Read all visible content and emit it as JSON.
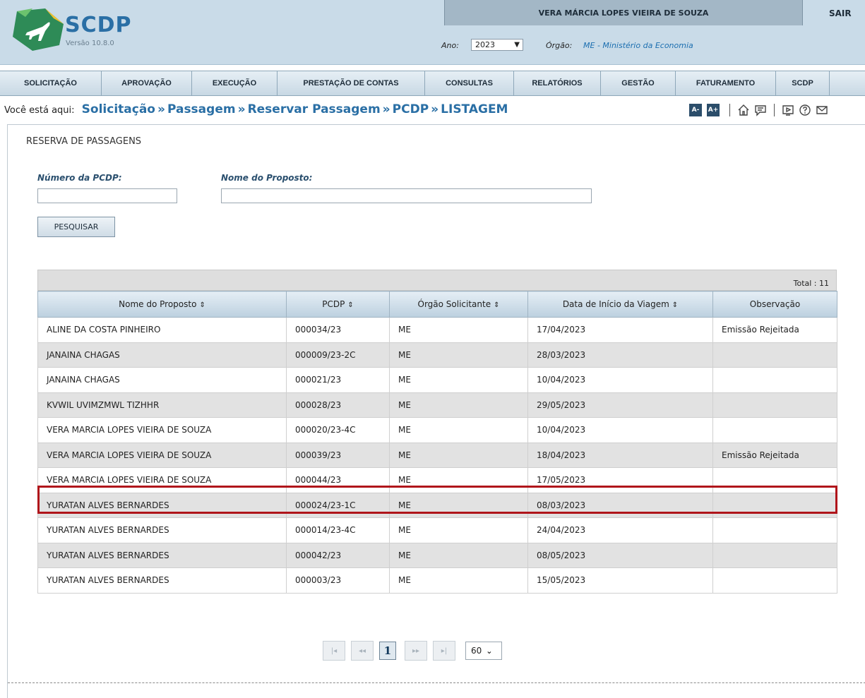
{
  "header": {
    "brand": "SCDP",
    "version": "Versão 10.8.0",
    "user_name": "VERA MÁRCIA LOPES VIEIRA DE SOUZA",
    "logout": "SAIR",
    "year_label": "Ano:",
    "year_value": "2023",
    "org_label": "Órgão:",
    "org_value": "ME - Ministério da Economia"
  },
  "menu": [
    {
      "label": "SOLICITAÇÃO"
    },
    {
      "label": "APROVAÇÃO"
    },
    {
      "label": "EXECUÇÃO"
    },
    {
      "label": "PRESTAÇÃO DE CONTAS"
    },
    {
      "label": "CONSULTAS"
    },
    {
      "label": "RELATÓRIOS"
    },
    {
      "label": "GESTÃO"
    },
    {
      "label": "FATURAMENTO"
    },
    {
      "label": "SCDP"
    }
  ],
  "breadcrumb": {
    "lead": "Você está aqui:",
    "items": [
      "Solicitação",
      "Passagem",
      "Reservar Passagem",
      "PCDP",
      "LISTAGEM"
    ],
    "separator": "»"
  },
  "tools": {
    "font_decrease": "A-",
    "font_increase": "A+"
  },
  "form": {
    "section_title": "RESERVA DE PASSAGENS",
    "pcdp_label": "Número da PCDP:",
    "pcdp_value": "",
    "name_label": "Nome do Proposto:",
    "name_value": "",
    "search_button": "PESQUISAR"
  },
  "table": {
    "total_label": "Total : 11",
    "columns": [
      {
        "label": "Nome do Proposto",
        "sortable": true
      },
      {
        "label": "PCDP",
        "sortable": true
      },
      {
        "label": "Órgão Solicitante",
        "sortable": true
      },
      {
        "label": "Data de Início da Viagem",
        "sortable": true
      },
      {
        "label": "Observação",
        "sortable": false
      }
    ],
    "rows": [
      [
        "ALINE DA COSTA PINHEIRO",
        "000034/23",
        "ME",
        "17/04/2023",
        "Emissão Rejeitada"
      ],
      [
        "JANAINA CHAGAS",
        "000009/23-2C",
        "ME",
        "28/03/2023",
        ""
      ],
      [
        "JANAINA CHAGAS",
        "000021/23",
        "ME",
        "10/04/2023",
        ""
      ],
      [
        "KVWIL UVIMZMWL TIZHHR",
        "000028/23",
        "ME",
        "29/05/2023",
        ""
      ],
      [
        "VERA MARCIA LOPES VIEIRA DE SOUZA",
        "000020/23-4C",
        "ME",
        "10/04/2023",
        ""
      ],
      [
        "VERA MARCIA LOPES VIEIRA DE SOUZA",
        "000039/23",
        "ME",
        "18/04/2023",
        "Emissão Rejeitada"
      ],
      [
        "VERA MARCIA LOPES VIEIRA DE SOUZA",
        "000044/23",
        "ME",
        "17/05/2023",
        ""
      ],
      [
        "YURATAN ALVES BERNARDES",
        "000024/23-1C",
        "ME",
        "08/03/2023",
        ""
      ],
      [
        "YURATAN ALVES BERNARDES",
        "000014/23-4C",
        "ME",
        "24/04/2023",
        ""
      ],
      [
        "YURATAN ALVES BERNARDES",
        "000042/23",
        "ME",
        "08/05/2023",
        ""
      ],
      [
        "YURATAN ALVES BERNARDES",
        "000003/23",
        "ME",
        "15/05/2023",
        ""
      ]
    ],
    "highlighted_row": 6,
    "highlight_color": "#b0151b"
  },
  "pagination": {
    "first": "|◂",
    "prev": "◂◂",
    "current": "1",
    "next": "▸▸",
    "last": "▸|",
    "page_size": "60"
  },
  "colors": {
    "brand_blue": "#2a6fa5",
    "header_bg": "#c9dbe8",
    "link_blue": "#1c6fb0"
  }
}
